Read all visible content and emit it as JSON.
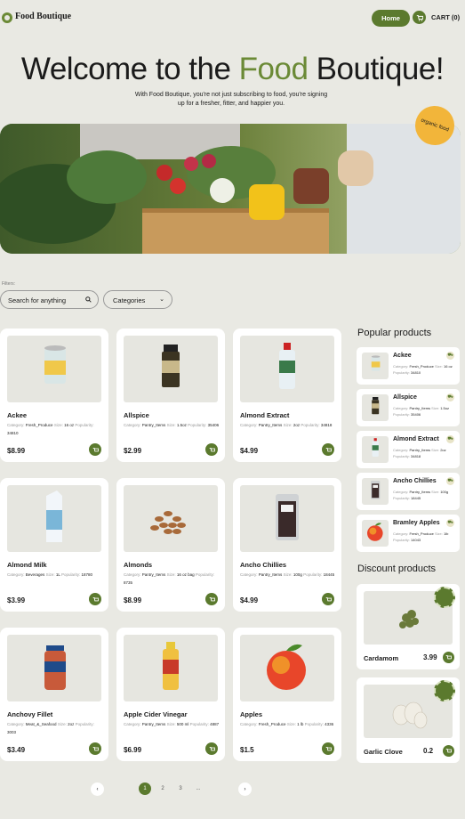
{
  "header": {
    "logo_text": "Food Boutique",
    "nav_home": "Home",
    "cart_label": "CART (0)"
  },
  "hero": {
    "title_before": "Welcome to the ",
    "title_accent": "Food",
    "title_after": " Boutique!",
    "subtitle": "With Food Boutique, you're not just subscribing to food, you're signing up for a fresher, fitter, and happier you.",
    "badge_text": "organic food"
  },
  "filters": {
    "label": "Filters:",
    "search_placeholder": "Search for anything",
    "category_selected": "Categories"
  },
  "products": [
    {
      "name": "Ackee",
      "category": "Fresh_Produce",
      "size": "16 oz",
      "popularity": "34810",
      "price": "$8.99"
    },
    {
      "name": "Allspice",
      "category": "Pantry_Items",
      "size": "1.5oz",
      "popularity": "35406",
      "price": "$2.99"
    },
    {
      "name": "Almond Extract",
      "category": "Pantry_Items",
      "size": "2oz",
      "popularity": "34818",
      "price": "$4.99"
    },
    {
      "name": "Almond Milk",
      "category": "Beverages",
      "size": "1L",
      "popularity": "18780",
      "price": "$3.99"
    },
    {
      "name": "Almonds",
      "category": "Pantry_Items",
      "size": "16 oz bag",
      "popularity": "8735",
      "price": "$8.99"
    },
    {
      "name": "Ancho Chillies",
      "category": "Pantry_Items",
      "size": "100g",
      "popularity": "18445",
      "price": "$4.99"
    },
    {
      "name": "Anchovy Fillet",
      "category": "Meat_&_Seafood",
      "size": "2oz",
      "popularity": "3003",
      "price": "$3.49"
    },
    {
      "name": "Apple Cider Vinegar",
      "category": "Pantry_Items",
      "size": "500 ml",
      "popularity": "4887",
      "price": "$6.99"
    },
    {
      "name": "Apples",
      "category": "Fresh_Produce",
      "size": "1 lb",
      "popularity": "4336",
      "price": "$1.5"
    }
  ],
  "labels": {
    "category": "Category:",
    "size": "Size:",
    "popularity": "Popularity:"
  },
  "popular": {
    "title": "Popular products",
    "items": [
      {
        "name": "Ackee",
        "category": "Fresh_Produce",
        "size": "16 oz",
        "popularity": "34810"
      },
      {
        "name": "Allspice",
        "category": "Pantry_Items",
        "size": "1.5oz",
        "popularity": "35406"
      },
      {
        "name": "Almond Extract",
        "category": "Pantry_Items",
        "size": "2oz",
        "popularity": "34818"
      },
      {
        "name": "Ancho Chillies",
        "category": "Pantry_Items",
        "size": "100g",
        "popularity": "18445"
      },
      {
        "name": "Bramley Apples",
        "category": "Fresh_Produce",
        "size": "1lb",
        "popularity": "14043"
      }
    ]
  },
  "discount": {
    "title": "Discount products",
    "items": [
      {
        "name": "Cardamom",
        "price": "3.99"
      },
      {
        "name": "Garlic Clove",
        "price": "0.2"
      }
    ]
  },
  "pagination": {
    "prev": "‹",
    "pages": [
      "1",
      "2",
      "3"
    ],
    "ellipsis": "...",
    "next": "›"
  },
  "icons": {
    "cart": "cart-icon",
    "search": "search-icon",
    "chevron": "chevron-down-icon"
  },
  "colors": {
    "accent": "#6b8a36",
    "button": "#5b7a2e",
    "background": "#e9e9e3",
    "badge": "#f2b53a"
  }
}
